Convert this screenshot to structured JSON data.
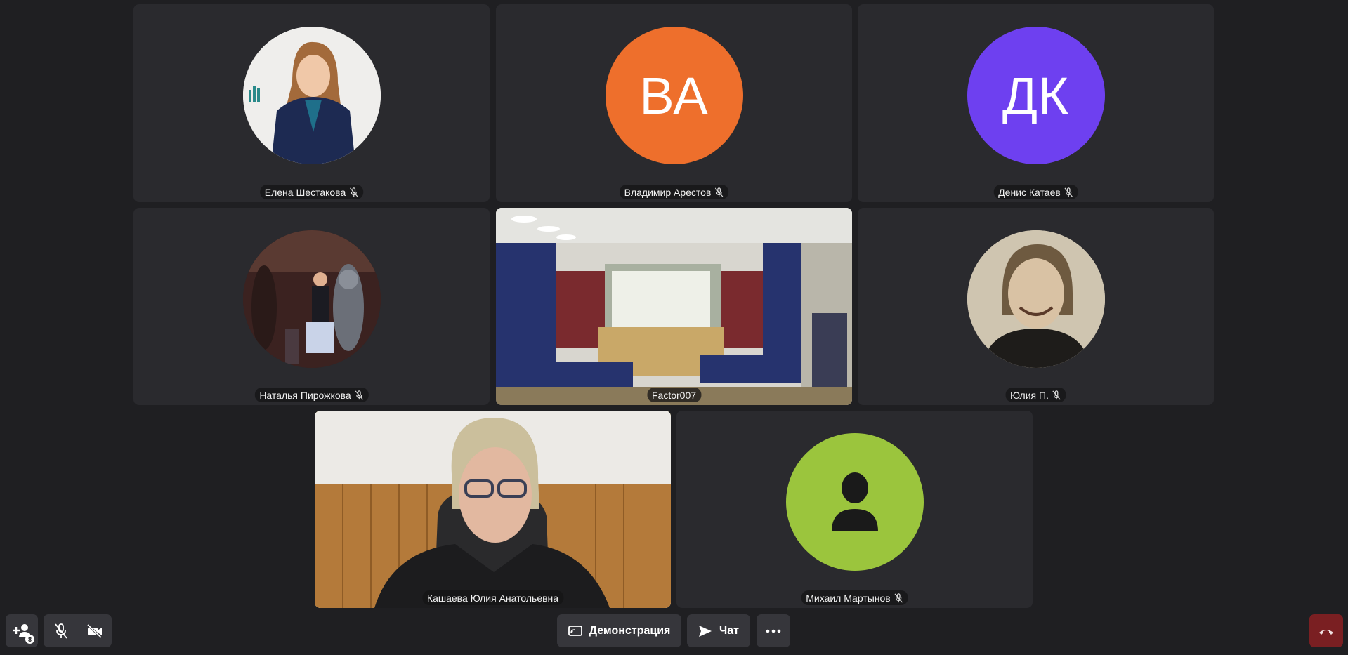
{
  "participants": [
    {
      "name": "Елена Шестакова",
      "muted": true,
      "type": "photo"
    },
    {
      "name": "Владимир Арестов",
      "muted": true,
      "type": "initials",
      "initials": "ВА",
      "color": "#ee6f2c"
    },
    {
      "name": "Денис Катаев",
      "muted": true,
      "type": "initials",
      "initials": "ДК",
      "color": "#6e40f0"
    },
    {
      "name": "Наталья Пирожкова",
      "muted": true,
      "type": "photo"
    },
    {
      "name": "Factor007",
      "muted": false,
      "type": "video"
    },
    {
      "name": "Юлия П.",
      "muted": true,
      "type": "photo"
    },
    {
      "name": "Кашаева Юлия Анатольевна",
      "muted": false,
      "type": "video",
      "speaking": true
    },
    {
      "name": "Михаил Мартынов",
      "muted": true,
      "type": "placeholder",
      "color": "#9bc53d"
    }
  ],
  "toolbar": {
    "invite_badge": "8",
    "demo_label": "Демонстрация",
    "chat_label": "Чат"
  },
  "colors": {
    "background": "#1f1f22",
    "tile": "#2a2a2e",
    "speaking_border": "#f5d34a",
    "hangup": "#7a1f22"
  }
}
